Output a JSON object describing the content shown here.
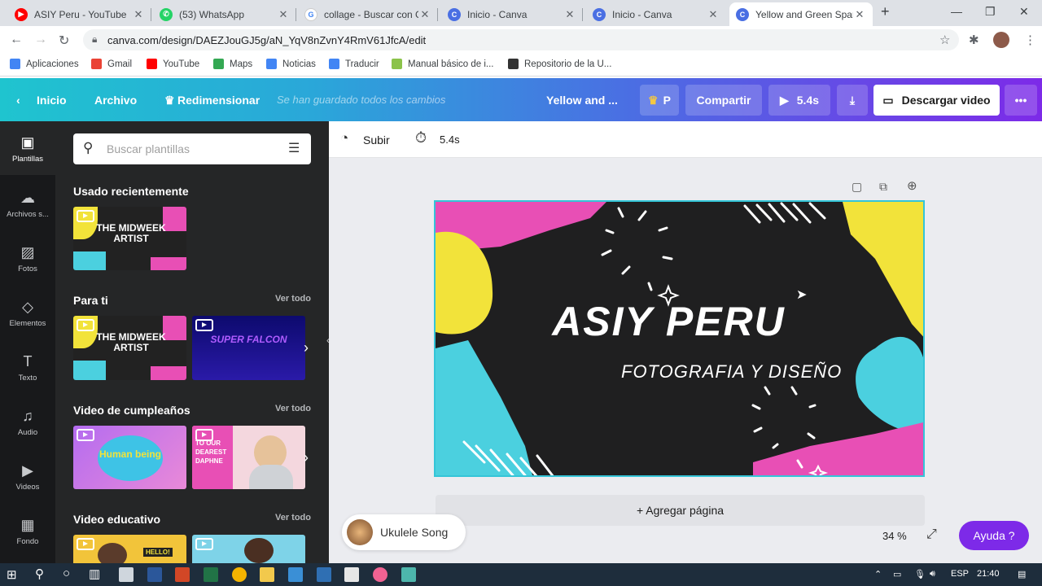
{
  "tabs": [
    {
      "title": "ASIY Peru - YouTube",
      "favicon_color": "#ff0000",
      "favicon": "youtube-icon"
    },
    {
      "title": "(53) WhatsApp",
      "favicon_color": "#25d366",
      "favicon": "whatsapp-icon"
    },
    {
      "title": "collage - Buscar con Go",
      "favicon_color": "#ffffff",
      "favicon": "google-icon"
    },
    {
      "title": "Inicio - Canva",
      "favicon_color": "#4a6fe3",
      "favicon": "canva-icon"
    },
    {
      "title": "Inicio - Canva",
      "favicon_color": "#4a6fe3",
      "favicon": "canva-icon"
    },
    {
      "title": "Yellow and Green Spar",
      "favicon_color": "#4a6fe3",
      "favicon": "canva-icon"
    }
  ],
  "address": {
    "url": "canva.com/design/DAEZJouGJ5g/aN_YqV8nZvnY4RmV61JfcA/edit"
  },
  "bookmarks": [
    {
      "label": "Aplicaciones",
      "color": "#4285f4"
    },
    {
      "label": "Gmail",
      "color": "#ea4335"
    },
    {
      "label": "YouTube",
      "color": "#ff0000"
    },
    {
      "label": "Maps",
      "color": "#34a853"
    },
    {
      "label": "Noticias",
      "color": "#4285f4"
    },
    {
      "label": "Traducir",
      "color": "#4285f4"
    },
    {
      "label": "Manual básico de i...",
      "color": "#8bc34a"
    },
    {
      "label": "Repositorio de la U...",
      "color": "#333333"
    }
  ],
  "header": {
    "home": "Inicio",
    "file": "Archivo",
    "resize": "Redimensionar",
    "saved": "Se han guardado todos los cambios",
    "doc_title": "Yellow and ...",
    "pro_letter": "P",
    "share": "Compartir",
    "play_duration": "5.4s",
    "download": "Descargar video",
    "more": "•••"
  },
  "rail": [
    {
      "label": "Plantillas",
      "glyph": "▣"
    },
    {
      "label": "Archivos s...",
      "glyph": "☁"
    },
    {
      "label": "Fotos",
      "glyph": "▨"
    },
    {
      "label": "Elementos",
      "glyph": "◇"
    },
    {
      "label": "Texto",
      "glyph": "T"
    },
    {
      "label": "Audio",
      "glyph": "♫"
    },
    {
      "label": "Videos",
      "glyph": "▶"
    },
    {
      "label": "Fondo",
      "glyph": "▦"
    }
  ],
  "panel": {
    "search_placeholder": "Buscar plantillas",
    "recent": "Usado recientemente",
    "foryou": "Para ti",
    "birthday": "Video de cumpleaños",
    "edu": "Video educativo",
    "see_all": "Ver todo",
    "thumb_midweek": "THE MIDWEEK ARTIST",
    "thumb_falcon": "SUPER FALCON",
    "thumb_human": "Human being",
    "thumb_dearest": "TO OUR DEAREST DAPHNE",
    "thumb_hello": "HELLO!"
  },
  "toolbar": {
    "upload": "Subir",
    "duration": "5.4s"
  },
  "design": {
    "title": "ASIY PERU",
    "subtitle": "FOTOGRAFIA Y DISEÑO"
  },
  "stage": {
    "add_page": "+ Agregar página",
    "song": "Ukulele Song",
    "zoom": "34 %",
    "help": "Ayuda ?"
  },
  "tray": {
    "lang": "ESP",
    "time": "21:40"
  },
  "colors": {
    "accent": "#7d2ae8",
    "pink": "#e84fb5",
    "yellow": "#f2e33a",
    "cyan": "#4bd0df"
  }
}
